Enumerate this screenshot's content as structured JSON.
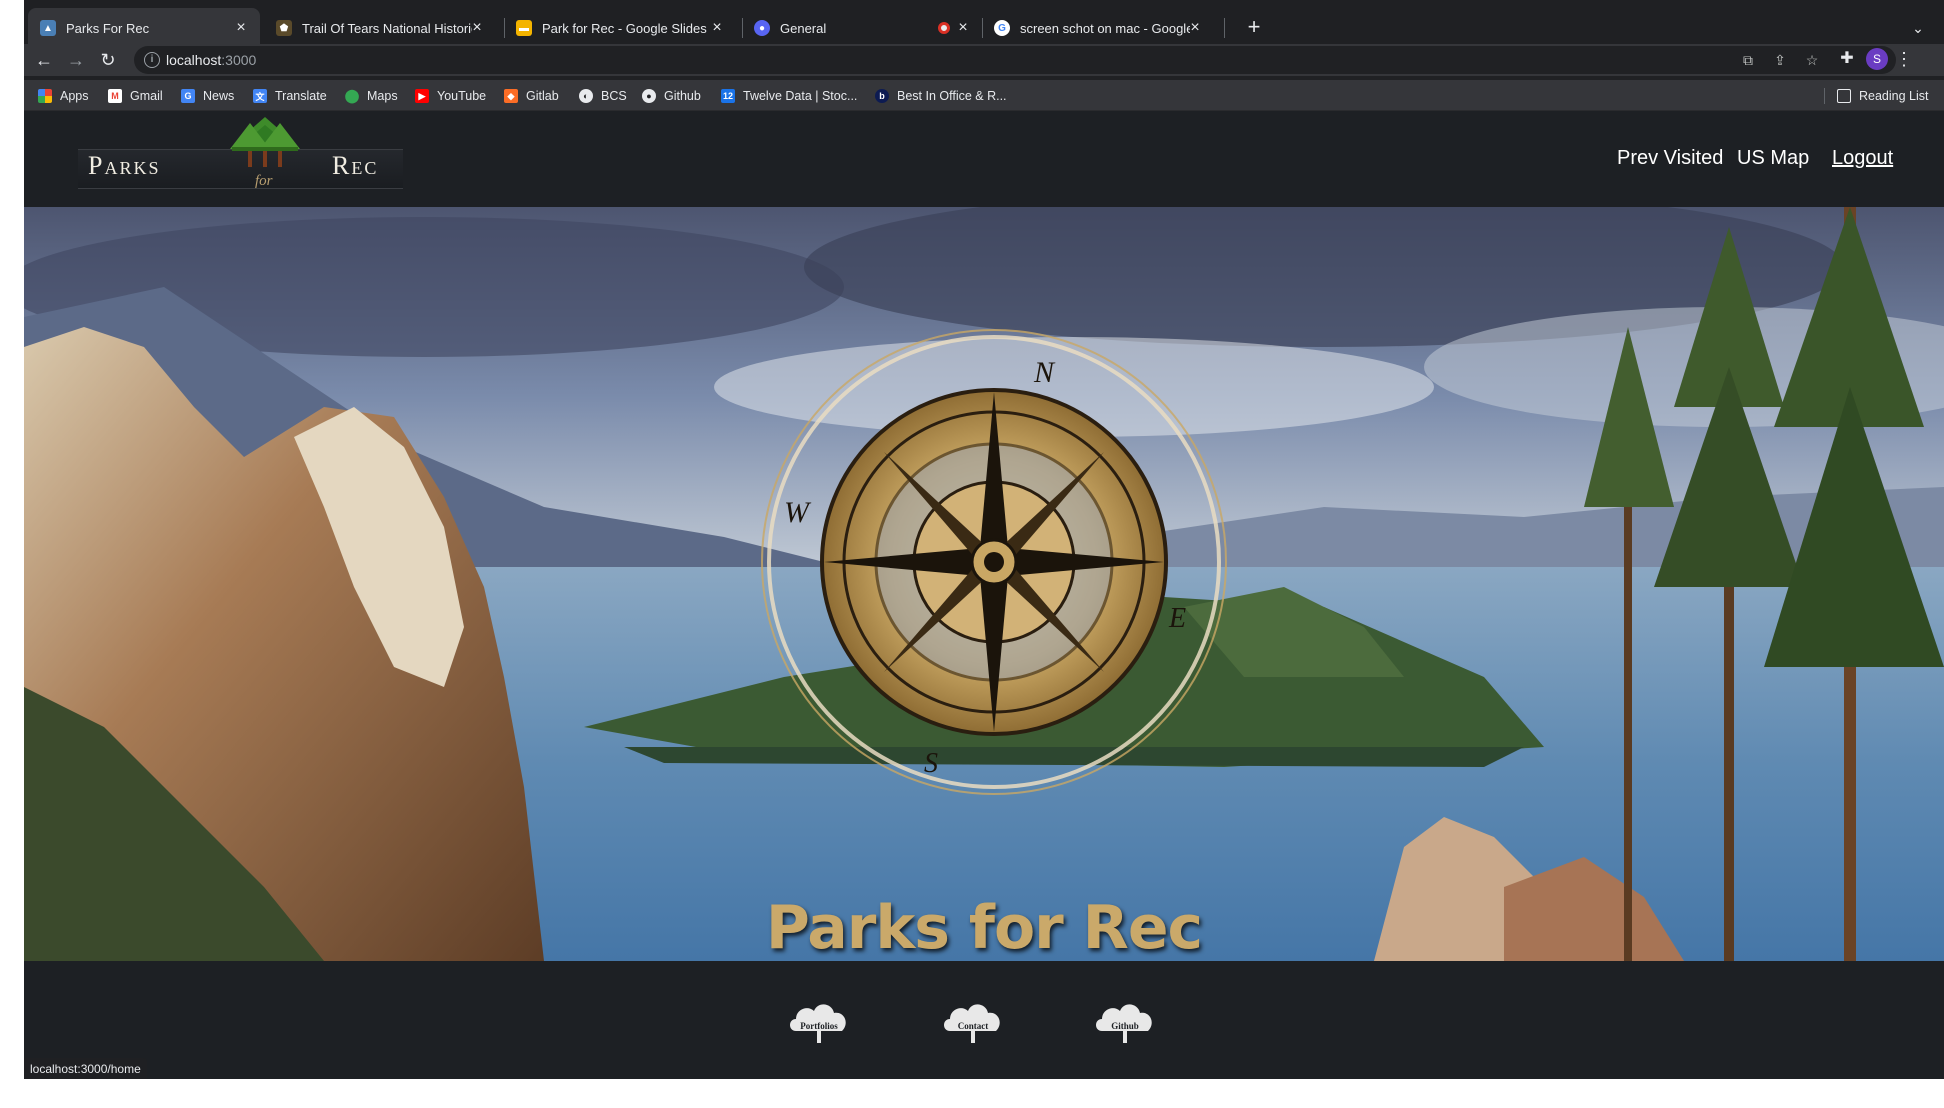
{
  "tabs": [
    {
      "title": "Parks For Rec",
      "active": true,
      "favicon": "map-favicon"
    },
    {
      "title": "Trail Of Tears National Historic",
      "active": false,
      "favicon": "nps-favicon"
    },
    {
      "title": "Park for Rec - Google Slides",
      "active": false,
      "favicon": "slides-favicon"
    },
    {
      "title": "General",
      "active": false,
      "favicon": "discord-favicon"
    },
    {
      "title": "screen schot on mac - Google",
      "active": false,
      "favicon": "google-favicon"
    }
  ],
  "address_bar": {
    "host": "localhost",
    "port": ":3000"
  },
  "bookmarks": [
    {
      "label": "Apps",
      "icon": "apps-grid-icon"
    },
    {
      "label": "Gmail",
      "icon": "gmail-icon"
    },
    {
      "label": "News",
      "icon": "news-icon"
    },
    {
      "label": "Translate",
      "icon": "translate-icon"
    },
    {
      "label": "Maps",
      "icon": "maps-icon"
    },
    {
      "label": "YouTube",
      "icon": "youtube-icon"
    },
    {
      "label": "Gitlab",
      "icon": "gitlab-icon"
    },
    {
      "label": "BCS",
      "icon": "bcs-icon"
    },
    {
      "label": "Github",
      "icon": "github-icon"
    },
    {
      "label": "Twelve Data | Stoc...",
      "icon": "twelve-data-icon"
    },
    {
      "label": "Best In Office & R...",
      "icon": "best-in-office-icon"
    }
  ],
  "reading_list": "Reading List",
  "profile_initial": "S",
  "site": {
    "logo": {
      "left_word": "Parks",
      "middle_word": "for",
      "right_word": "Rec"
    },
    "nav": {
      "prev_visited": "Prev Visited",
      "us_map": "US Map",
      "logout": "Logout"
    },
    "hero": {
      "title": "Parks for Rec",
      "compass_letters": {
        "n": "N",
        "e": "E",
        "s": "S",
        "w": "W"
      }
    },
    "footer": [
      {
        "label": "Portfolios",
        "icon": "tree-cloud-icon"
      },
      {
        "label": "Contact",
        "icon": "tree-cloud-icon"
      },
      {
        "label": "Github",
        "icon": "tree-cloud-icon"
      }
    ]
  },
  "status_bar": "localhost:3000/home",
  "colors": {
    "page_bg": "#1d2024",
    "title_gold": "#caa96a",
    "chrome_bg": "#35363a"
  }
}
